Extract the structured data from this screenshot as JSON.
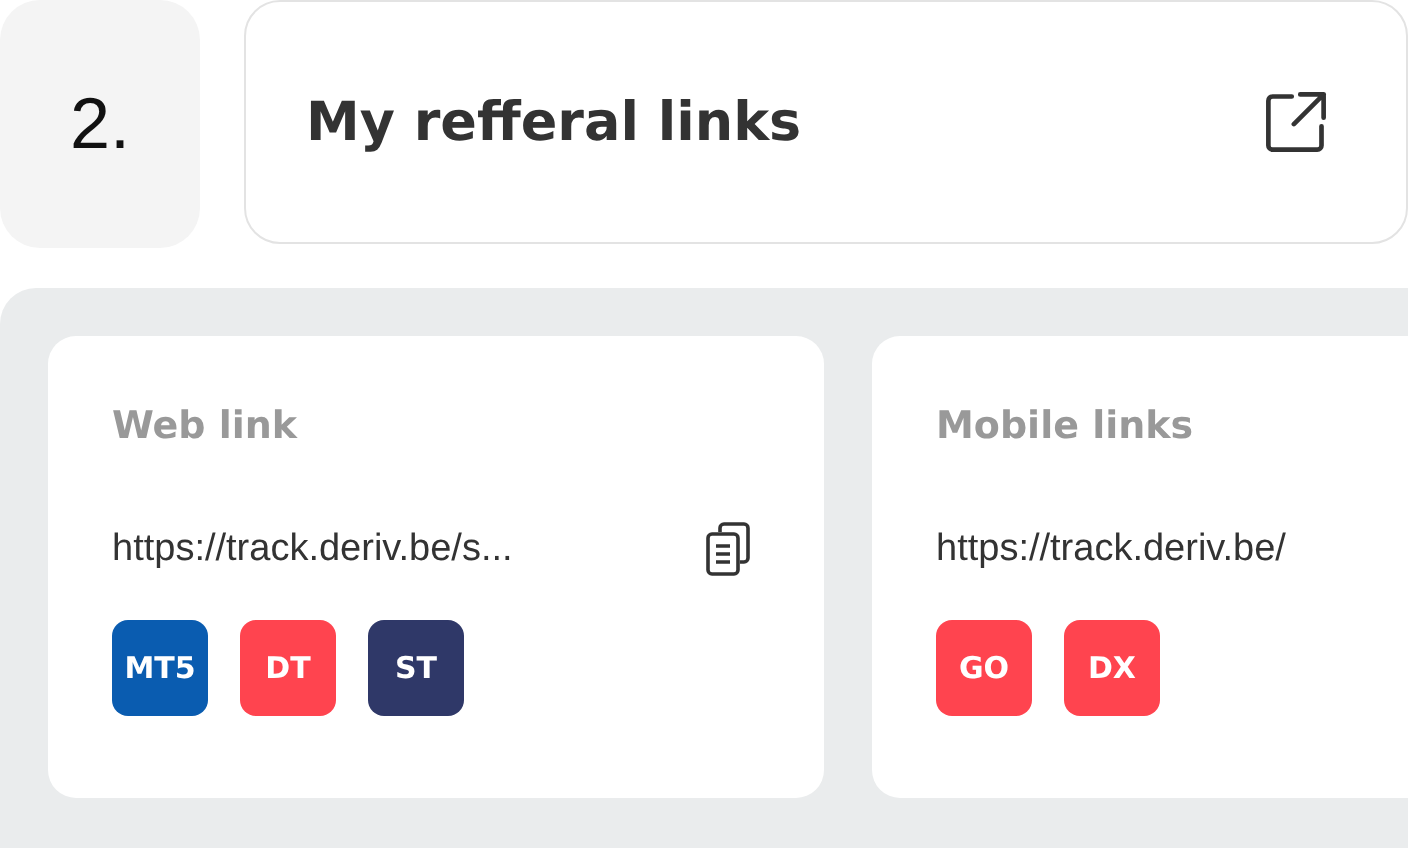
{
  "step": {
    "number": "2.",
    "title": "My refferal links"
  },
  "cards": [
    {
      "title": "Web link",
      "url": "https://track.deriv.be/s...",
      "apps": [
        {
          "label": "MT5",
          "color": "#0a5cb0"
        },
        {
          "label": "DT",
          "color": "#ff444f"
        },
        {
          "label": "ST",
          "color": "#2f3868"
        }
      ]
    },
    {
      "title": "Mobile links",
      "url": "https://track.deriv.be/",
      "apps": [
        {
          "label": "GO",
          "color": "#ff444f"
        },
        {
          "label": "DX",
          "color": "#ff444f"
        }
      ]
    }
  ]
}
